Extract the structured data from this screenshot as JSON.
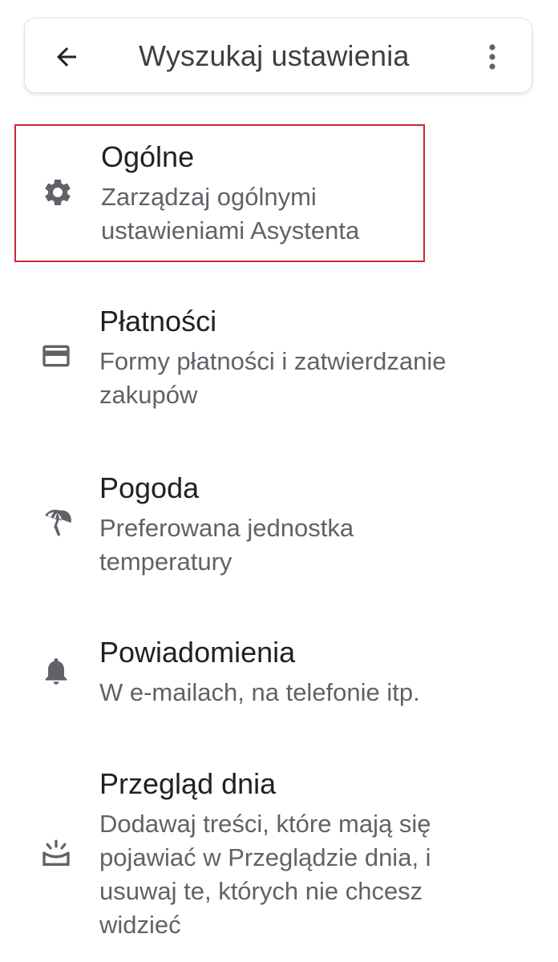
{
  "search": {
    "placeholder": "Wyszukaj ustawienia"
  },
  "items": [
    {
      "title": "Ogólne",
      "subtitle": "Zarządzaj ogólnymi ustawieniami Asystenta",
      "icon": "gear-icon"
    },
    {
      "title": "Płatności",
      "subtitle": "Formy płatności i zatwierdzanie zakupów",
      "icon": "credit-card-icon"
    },
    {
      "title": "Pogoda",
      "subtitle": "Preferowana jednostka temperatury",
      "icon": "umbrella-icon"
    },
    {
      "title": "Powiadomienia",
      "subtitle": "W e-mailach, na telefonie itp.",
      "icon": "bell-icon"
    },
    {
      "title": "Przegląd dnia",
      "subtitle": "Dodawaj treści, które mają się pojawiać w Przeglądzie dnia, i usuwaj te, których nie chcesz widzieć",
      "icon": "sunrise-icon"
    }
  ],
  "colors": {
    "highlight": "#d0252f",
    "icon": "#5f6368"
  }
}
